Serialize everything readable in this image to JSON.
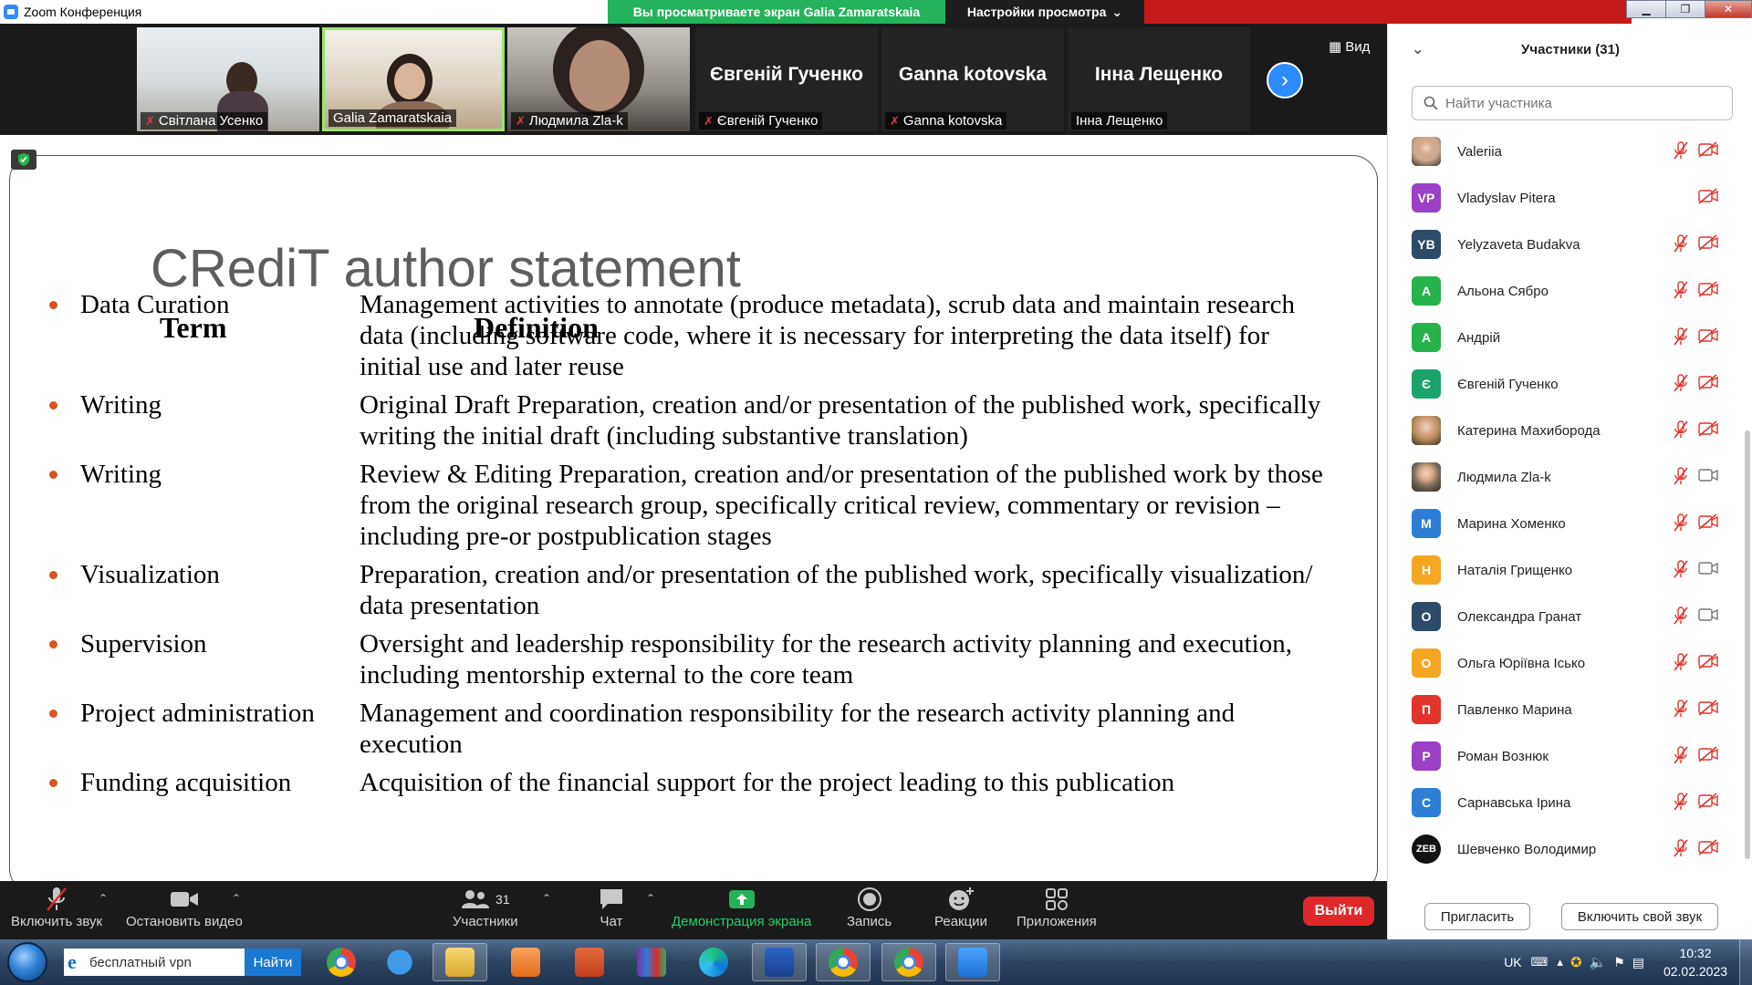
{
  "window": {
    "title": "Zoom Конференция",
    "share_banner": "Вы просматриваете экран Galia Zamaratskaia",
    "view_settings": "Настройки просмотра"
  },
  "videos": {
    "view_label": "Вид",
    "tiles": [
      {
        "name": "Світлана Усенко",
        "muted": true
      },
      {
        "name": "Galia Zamaratskaia",
        "muted": false
      },
      {
        "name": "Людмила Zla-k",
        "muted": true
      },
      {
        "name": "Євгеній Гученко",
        "big_name": "Євгеній Гученко",
        "muted": true
      },
      {
        "name": "Ganna kotovska",
        "big_name": "Ganna kotovska",
        "muted": true
      },
      {
        "name": "Інна Лещенко",
        "big_name": "Інна Лещенко",
        "muted": false
      }
    ]
  },
  "slide": {
    "title": "CRediT author statement",
    "col_term": "Term",
    "col_definition": "Definition",
    "rows": [
      {
        "term": "Data Curation",
        "definition": "Management activities to annotate (produce metadata), scrub data and maintain research data (including software code, where it is necessary for interpreting the data itself) for initial use and later reuse"
      },
      {
        "term": "Writing",
        "definition": "Original Draft      Preparation, creation and/or presentation of the published work, specifically writing the initial draft (including substantive translation)"
      },
      {
        "term": "Writing",
        "definition": "Review & Editing Preparation, creation and/or presentation of the published work by those from the original research group, specifically critical review, commentary or revision – including pre-or postpublication stages"
      },
      {
        "term": "Visualization",
        "definition": "Preparation, creation and/or presentation of the published work, specifically visualization/ data presentation"
      },
      {
        "term": "Supervision",
        "definition": "Oversight and leadership responsibility for the research activity planning and execution, including mentorship external to the core team"
      },
      {
        "term": "Project administration",
        "definition": "Management and coordination responsibility for the research activity planning and execution"
      },
      {
        "term": "Funding acquisition",
        "definition": "Acquisition of the financial support for the project leading to this publication"
      }
    ]
  },
  "toolbar": {
    "unmute": "Включить звук",
    "stop_video": "Остановить видео",
    "participants": "Участники",
    "participants_count": "31",
    "chat": "Чат",
    "share_screen": "Демонстрация экрана",
    "record": "Запись",
    "reactions": "Реакции",
    "apps": "Приложения",
    "leave": "Выйти"
  },
  "panel": {
    "title": "Участники (31)",
    "search_placeholder": "Найти участника",
    "invite": "Пригласить",
    "unmute_me": "Включить свой звук",
    "participants": [
      {
        "name": "Valeriia",
        "initials": "",
        "color": "#c9a98f",
        "photo": true,
        "mic_muted": true,
        "video_off": true
      },
      {
        "name": "Vladyslav Pitera",
        "initials": "VP",
        "color": "#9b3fc7",
        "photo": false,
        "mic_muted": false,
        "video_off": true
      },
      {
        "name": "Yelyzaveta Budakva",
        "initials": "YB",
        "color": "#2d4a6b",
        "photo": false,
        "mic_muted": true,
        "video_off": true
      },
      {
        "name": "Альона Сябро",
        "initials": "А",
        "color": "#27b34b",
        "photo": false,
        "mic_muted": true,
        "video_off": true
      },
      {
        "name": "Андрій",
        "initials": "А",
        "color": "#27b34b",
        "photo": false,
        "mic_muted": true,
        "video_off": true
      },
      {
        "name": "Євгеній Гученко",
        "initials": "Є",
        "color": "#1aa36b",
        "photo": false,
        "mic_muted": true,
        "video_off": true
      },
      {
        "name": "Катерина Махибородa",
        "initials": "",
        "color": "#b58c5a",
        "photo": true,
        "mic_muted": true,
        "video_off": true
      },
      {
        "name": "Людмила Zla-k",
        "initials": "",
        "color": "#7a6a5a",
        "photo": true,
        "mic_muted": true,
        "video_off": false
      },
      {
        "name": "Марина Хоменко",
        "initials": "М",
        "color": "#2d7fd6",
        "photo": false,
        "mic_muted": true,
        "video_off": true
      },
      {
        "name": "Наталія Грищенко",
        "initials": "Н",
        "color": "#f5a623",
        "photo": false,
        "mic_muted": true,
        "video_off": false
      },
      {
        "name": "Олександра Гранат",
        "initials": "О",
        "color": "#2d4a6b",
        "photo": false,
        "mic_muted": true,
        "video_off": false
      },
      {
        "name": "Ольга Юріївна Ісько",
        "initials": "О",
        "color": "#f5a623",
        "photo": false,
        "mic_muted": true,
        "video_off": true
      },
      {
        "name": "Павленко Марина",
        "initials": "П",
        "color": "#e0342c",
        "photo": false,
        "mic_muted": true,
        "video_off": true
      },
      {
        "name": "Роман Вознюк",
        "initials": "Р",
        "color": "#9b3fc7",
        "photo": false,
        "mic_muted": true,
        "video_off": true
      },
      {
        "name": "Сарнавська Ірина",
        "initials": "С",
        "color": "#2d7fd6",
        "photo": false,
        "mic_muted": true,
        "video_off": true
      },
      {
        "name": "Шевченко Володимир",
        "initials": "ZEB",
        "color": "#111111",
        "photo": false,
        "mic_muted": true,
        "video_off": true
      }
    ]
  },
  "taskbar": {
    "search_value": "бесплатный vpn",
    "find_button": "Найти",
    "lang": "UK",
    "time": "10:32",
    "date": "02.02.2023",
    "apps": [
      "chrome-icon",
      "ie-icon",
      "explorer-icon",
      "media-player-icon",
      "powerpoint-icon",
      "winrar-icon",
      "edge-icon",
      "word-icon",
      "chrome-profile-icon",
      "chrome-profile-icon",
      "zoom-icon"
    ]
  },
  "colors": {
    "share_green": "#24b35a",
    "zoom_blue": "#2d8cff",
    "leave_red": "#e02828",
    "bullet_orange": "#d9531e"
  }
}
